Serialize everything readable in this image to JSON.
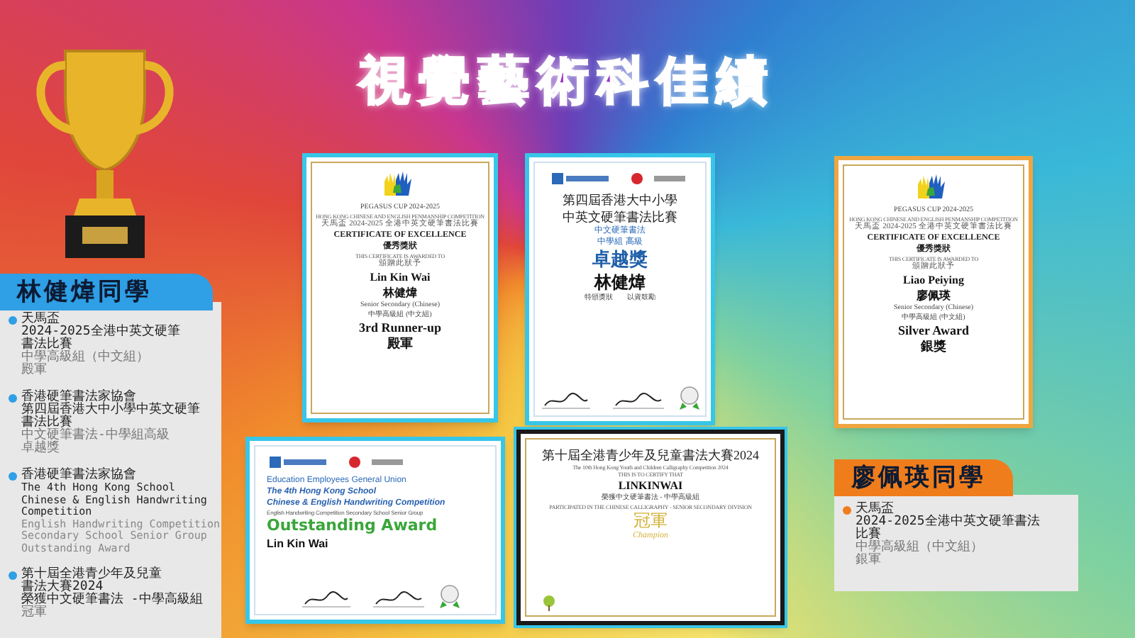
{
  "title": "視覺藝術科佳績",
  "certificates": [
    {
      "kind": "pegasus",
      "color": "#37c6e8",
      "lines": [
        {
          "text": "PEGASUS CUP 2024-2025",
          "kind": "small"
        },
        {
          "text": "HONG KONG CHINESE AND ENGLISH PENMANSHIP COMPETITION",
          "kind": "tiny"
        },
        {
          "text": "天馬盃 2024-2025 全港中英文硬筆書法比賽",
          "kind": "tiny-zh"
        },
        {
          "text": "CERTIFICATE OF EXCELLENCE",
          "kind": "heading"
        },
        {
          "text": "優秀獎狀",
          "kind": "heading"
        },
        {
          "text": "THIS CERTIFICATE IS AWARDED TO",
          "kind": "tiny"
        },
        {
          "text": "頒贈此狀予",
          "kind": "tiny-zh"
        },
        {
          "text": "Lin Kin Wai",
          "kind": "name"
        },
        {
          "text": "林健煒",
          "kind": "name"
        },
        {
          "text": "Senior Secondary (Chinese)",
          "kind": "small"
        },
        {
          "text": "中學高級組 (中文組)",
          "kind": "small"
        },
        {
          "text": "3rd Runner-up",
          "kind": "award"
        },
        {
          "text": "殿軍",
          "kind": "award"
        }
      ]
    },
    {
      "kind": "calligraphy",
      "color": "#37c6e8",
      "lines": [
        {
          "text": "第四屆香港大中小學",
          "kind": "zh-title"
        },
        {
          "text": "中英文硬筆書法比賽",
          "kind": "zh-title"
        },
        {
          "text": "中文硬筆書法",
          "kind": "blue-small"
        },
        {
          "text": "中學組 高級",
          "kind": "blue-small"
        },
        {
          "text": "卓越獎",
          "kind": "blue-big"
        },
        {
          "text": "林健煒",
          "kind": "zh-name"
        },
        {
          "text": "特頒獎狀　　以資鼓勵",
          "kind": "small"
        }
      ]
    },
    {
      "kind": "pegasus",
      "color": "#f0a640",
      "lines": [
        {
          "text": "PEGASUS CUP 2024-2025",
          "kind": "small"
        },
        {
          "text": "HONG KONG CHINESE AND ENGLISH PENMANSHIP COMPETITION",
          "kind": "tiny"
        },
        {
          "text": "天馬盃 2024-2025 全港中英文硬筆書法比賽",
          "kind": "tiny-zh"
        },
        {
          "text": "CERTIFICATE OF EXCELLENCE",
          "kind": "heading"
        },
        {
          "text": "優秀獎狀",
          "kind": "heading"
        },
        {
          "text": "THIS CERTIFICATE IS AWARDED TO",
          "kind": "tiny"
        },
        {
          "text": "頒贈此狀予",
          "kind": "tiny-zh"
        },
        {
          "text": "Liao Peiying",
          "kind": "name"
        },
        {
          "text": "廖佩瑛",
          "kind": "name"
        },
        {
          "text": "Senior Secondary (Chinese)",
          "kind": "small"
        },
        {
          "text": "中學高級組 (中文組)",
          "kind": "small"
        },
        {
          "text": "Silver Award",
          "kind": "award"
        },
        {
          "text": "銀獎",
          "kind": "award"
        }
      ]
    },
    {
      "kind": "union",
      "color": "#37c6e8",
      "lines": [
        {
          "text": "Education Employees General Union",
          "kind": "blue-small"
        },
        {
          "text": "The 4th Hong Kong School",
          "kind": "blue-italic"
        },
        {
          "text": "Chinese & English Handwriting Competition",
          "kind": "blue-italic"
        },
        {
          "text": "English Handwriting Competition Secondary School Senior Group",
          "kind": "tiny"
        },
        {
          "text": "Outstanding Award",
          "kind": "green-award"
        },
        {
          "text": "Lin Kin Wai",
          "kind": "name"
        }
      ]
    },
    {
      "kind": "youth",
      "color": "#1a1a1a",
      "lines": [
        {
          "text": "第十屆全港青少年及兒童書法大賽2024",
          "kind": "zh-title"
        },
        {
          "text": "The 10th Hong Kong Youth and Children Calligraphy Competition 2024",
          "kind": "tiny"
        },
        {
          "text": "THIS IS TO CERTIFY THAT",
          "kind": "tiny"
        },
        {
          "text": "LINKINWAI",
          "kind": "name"
        },
        {
          "text": "榮獲中文硬筆書法 - 中學高級組",
          "kind": "small"
        },
        {
          "text": "PARTICIPATED IN THE CHINESE CALLIGRAPHY - SENIOR SECONDARY DIVISION",
          "kind": "tiny"
        },
        {
          "text": "冠軍",
          "kind": "gold-award"
        },
        {
          "text": "Champion",
          "kind": "gold-small"
        }
      ]
    }
  ],
  "students": [
    {
      "name": "林健煒同學",
      "color": "#2f9fe6",
      "achievements": [
        {
          "lines": [
            {
              "text": "天馬盃",
              "kind": "title"
            },
            {
              "text": "2024-2025全港中英文硬筆",
              "kind": "title"
            },
            {
              "text": "書法比賽",
              "kind": "title"
            },
            {
              "text": "中學高級組（中文組）",
              "kind": "detail"
            },
            {
              "text": "殿軍",
              "kind": "detail"
            }
          ]
        },
        {
          "lines": [
            {
              "text": "香港硬筆書法家協會",
              "kind": "title"
            },
            {
              "text": "第四屆香港大中小學中英文硬筆",
              "kind": "title"
            },
            {
              "text": "書法比賽",
              "kind": "title"
            },
            {
              "text": "中文硬筆書法-中學組高級",
              "kind": "detail"
            },
            {
              "text": "卓越獎",
              "kind": "detail"
            }
          ]
        },
        {
          "lines": [
            {
              "text": "香港硬筆書法家協會",
              "kind": "title"
            },
            {
              "text": "The 4th Hong Kong School",
              "kind": "title_en"
            },
            {
              "text": "Chinese & English Handwriting",
              "kind": "title_en"
            },
            {
              "text": "Competition",
              "kind": "title_en"
            },
            {
              "text": "English Handwriting Competition",
              "kind": "detail_en"
            },
            {
              "text": "Secondary School Senior Group",
              "kind": "detail_en"
            },
            {
              "text": "Outstanding Award",
              "kind": "detail_en"
            }
          ]
        },
        {
          "lines": [
            {
              "text": "第十屆全港青少年及兒童",
              "kind": "title"
            },
            {
              "text": "書法大賽2024",
              "kind": "title"
            },
            {
              "text": "榮獲中文硬筆書法 -中學高級組",
              "kind": "title"
            },
            {
              "text": "冠軍",
              "kind": "detail"
            }
          ]
        }
      ]
    },
    {
      "name": "廖佩瑛同學",
      "color": "#f07d1c",
      "achievements": [
        {
          "lines": [
            {
              "text": "天馬盃",
              "kind": "title"
            },
            {
              "text": "2024-2025全港中英文硬筆書法",
              "kind": "title"
            },
            {
              "text": "比賽",
              "kind": "title"
            },
            {
              "text": "中學高級組（中文組）",
              "kind": "detail"
            },
            {
              "text": "銀軍",
              "kind": "detail"
            }
          ]
        }
      ]
    }
  ]
}
